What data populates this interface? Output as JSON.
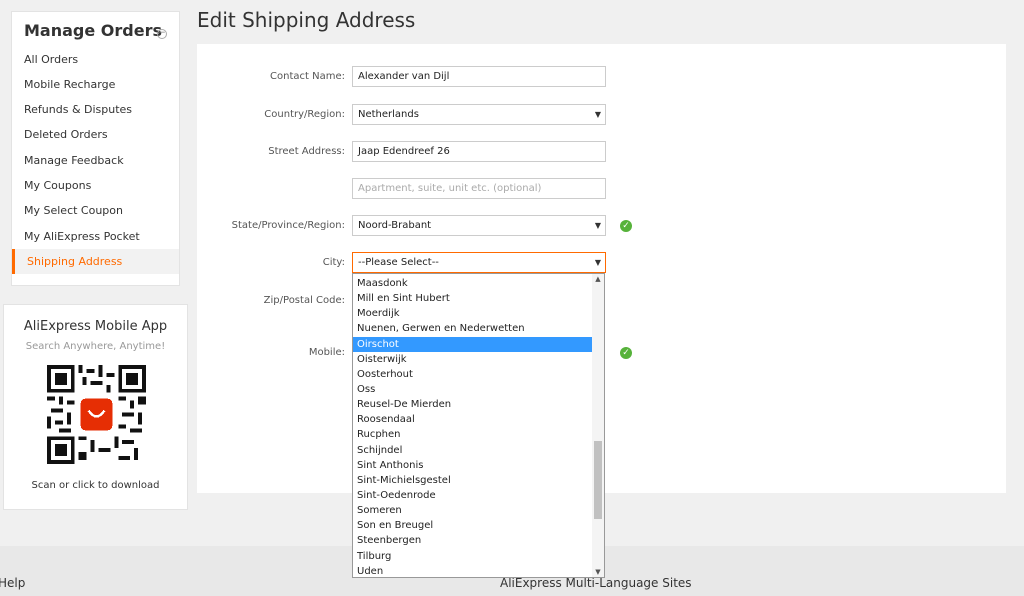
{
  "sidebar": {
    "title": "Manage Orders",
    "items": [
      {
        "label": "All Orders"
      },
      {
        "label": "Mobile Recharge"
      },
      {
        "label": "Refunds & Disputes"
      },
      {
        "label": "Deleted Orders"
      },
      {
        "label": "Manage Feedback"
      },
      {
        "label": "My Coupons"
      },
      {
        "label": "My Select Coupon"
      },
      {
        "label": "My AliExpress Pocket"
      },
      {
        "label": "Shipping Address",
        "active": true
      }
    ]
  },
  "app_promo": {
    "title": "AliExpress Mobile App",
    "subtitle": "Search Anywhere, Anytime!",
    "footer": "Scan or click to download"
  },
  "page": {
    "title": "Edit Shipping Address"
  },
  "form": {
    "contact_name": {
      "label": "Contact Name:",
      "value": "Alexander van Dijl"
    },
    "country": {
      "label": "Country/Region:",
      "value": "Netherlands"
    },
    "street": {
      "label": "Street Address:",
      "value": "Jaap Edendreef 26"
    },
    "street2": {
      "placeholder": "Apartment, suite, unit etc. (optional)"
    },
    "state": {
      "label": "State/Province/Region:",
      "value": "Noord-Brabant"
    },
    "city": {
      "label": "City:",
      "value": "--Please Select--"
    },
    "zip": {
      "label": "Zip/Postal Code:"
    },
    "mobile": {
      "label": "Mobile:"
    }
  },
  "city_options": [
    "Maasdonk",
    "Mill en Sint Hubert",
    "Moerdijk",
    "Nuenen, Gerwen en Nederwetten",
    "Oirschot",
    "Oisterwijk",
    "Oosterhout",
    "Oss",
    "Reusel-De Mierden",
    "Roosendaal",
    "Rucphen",
    "Schijndel",
    "Sint Anthonis",
    "Sint-Michielsgestel",
    "Sint-Oedenrode",
    "Someren",
    "Son en Breugel",
    "Steenbergen",
    "Tilburg",
    "Uden"
  ],
  "city_highlighted": "Oirschot",
  "footer": {
    "help": "Help",
    "sites": "AliExpress Multi-Language Sites"
  },
  "colors": {
    "accent": "#ff6a00",
    "highlight": "#3399ff",
    "ok": "#56b23a"
  }
}
